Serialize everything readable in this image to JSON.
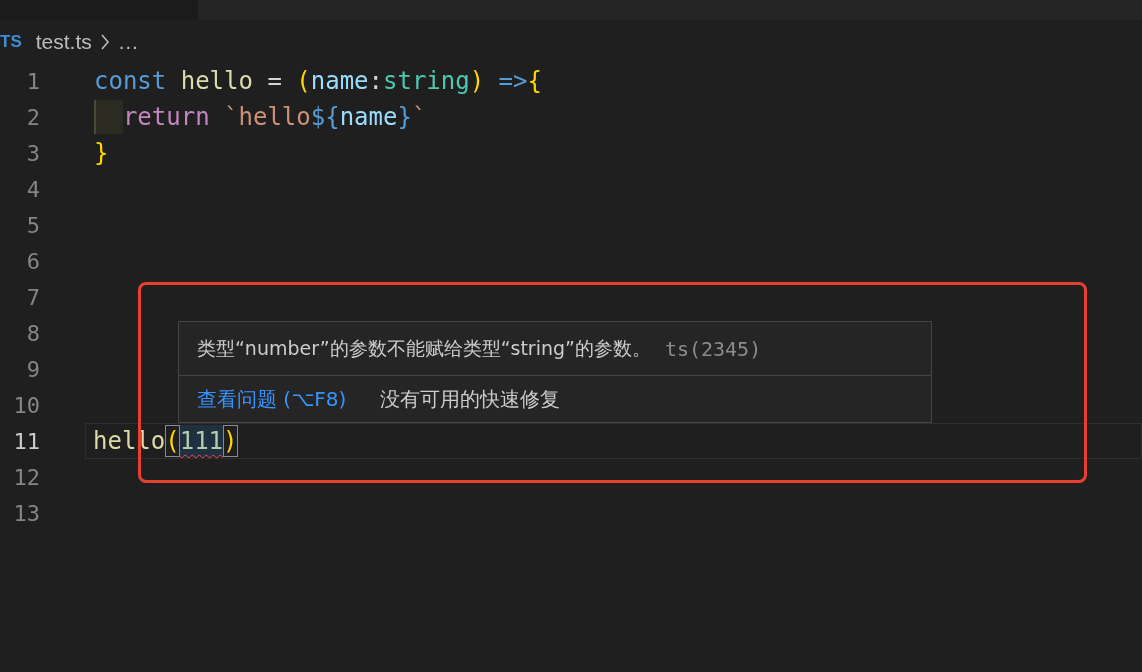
{
  "breadcrumb": {
    "file_badge": "TS",
    "file": "test.ts",
    "more": "…"
  },
  "lines": [
    {
      "number": "1",
      "current": false,
      "indent_guide": false,
      "tokens": [
        {
          "kind": "keyword",
          "text": "const "
        },
        {
          "kind": "function",
          "text": "hello"
        },
        {
          "kind": "plain",
          "text": " = "
        },
        {
          "kind": "bracket",
          "text": "("
        },
        {
          "kind": "param",
          "text": "name"
        },
        {
          "kind": "plain",
          "text": ":"
        },
        {
          "kind": "type",
          "text": "string"
        },
        {
          "kind": "bracket",
          "text": ")"
        },
        {
          "kind": "keyword",
          "text": " =>"
        },
        {
          "kind": "bracket",
          "text": "{"
        }
      ]
    },
    {
      "number": "2",
      "current": false,
      "indent_guide": true,
      "tokens": [
        {
          "kind": "control",
          "text": "return "
        },
        {
          "kind": "string",
          "text": "`hello"
        },
        {
          "kind": "keyword",
          "text": "${"
        },
        {
          "kind": "param",
          "text": "name"
        },
        {
          "kind": "keyword",
          "text": "}"
        },
        {
          "kind": "string",
          "text": "`"
        }
      ]
    },
    {
      "number": "3",
      "current": false,
      "indent_guide": false,
      "tokens": [
        {
          "kind": "bracket",
          "text": "}"
        }
      ]
    },
    {
      "number": "4",
      "current": false,
      "indent_guide": false
    },
    {
      "number": "5",
      "current": false,
      "indent_guide": false
    },
    {
      "number": "6",
      "current": false,
      "indent_guide": false
    },
    {
      "number": "7",
      "current": false,
      "indent_guide": false
    },
    {
      "number": "8",
      "current": false,
      "indent_guide": false
    },
    {
      "number": "9",
      "current": false,
      "indent_guide": false
    },
    {
      "number": "10",
      "current": false,
      "indent_guide": false
    },
    {
      "number": "11",
      "current": true,
      "indent_guide": false,
      "tokens": [
        {
          "kind": "function",
          "text": "hello",
          "matched": false,
          "error": false
        },
        {
          "kind": "bracket",
          "text": "(",
          "matched": true,
          "error": false
        },
        {
          "kind": "number",
          "text": "111",
          "matched": false,
          "error": true
        },
        {
          "kind": "bracket",
          "text": ")",
          "matched": true,
          "error": false
        }
      ]
    },
    {
      "number": "12",
      "current": false,
      "indent_guide": false
    },
    {
      "number": "13",
      "current": false,
      "indent_guide": false
    }
  ],
  "hover": {
    "message": "类型“number”的参数不能赋给类型“string”的参数。",
    "code": "ts(2345)",
    "action_link": "查看问题 (⌥F8)",
    "note": "没有可用的快速修复"
  }
}
